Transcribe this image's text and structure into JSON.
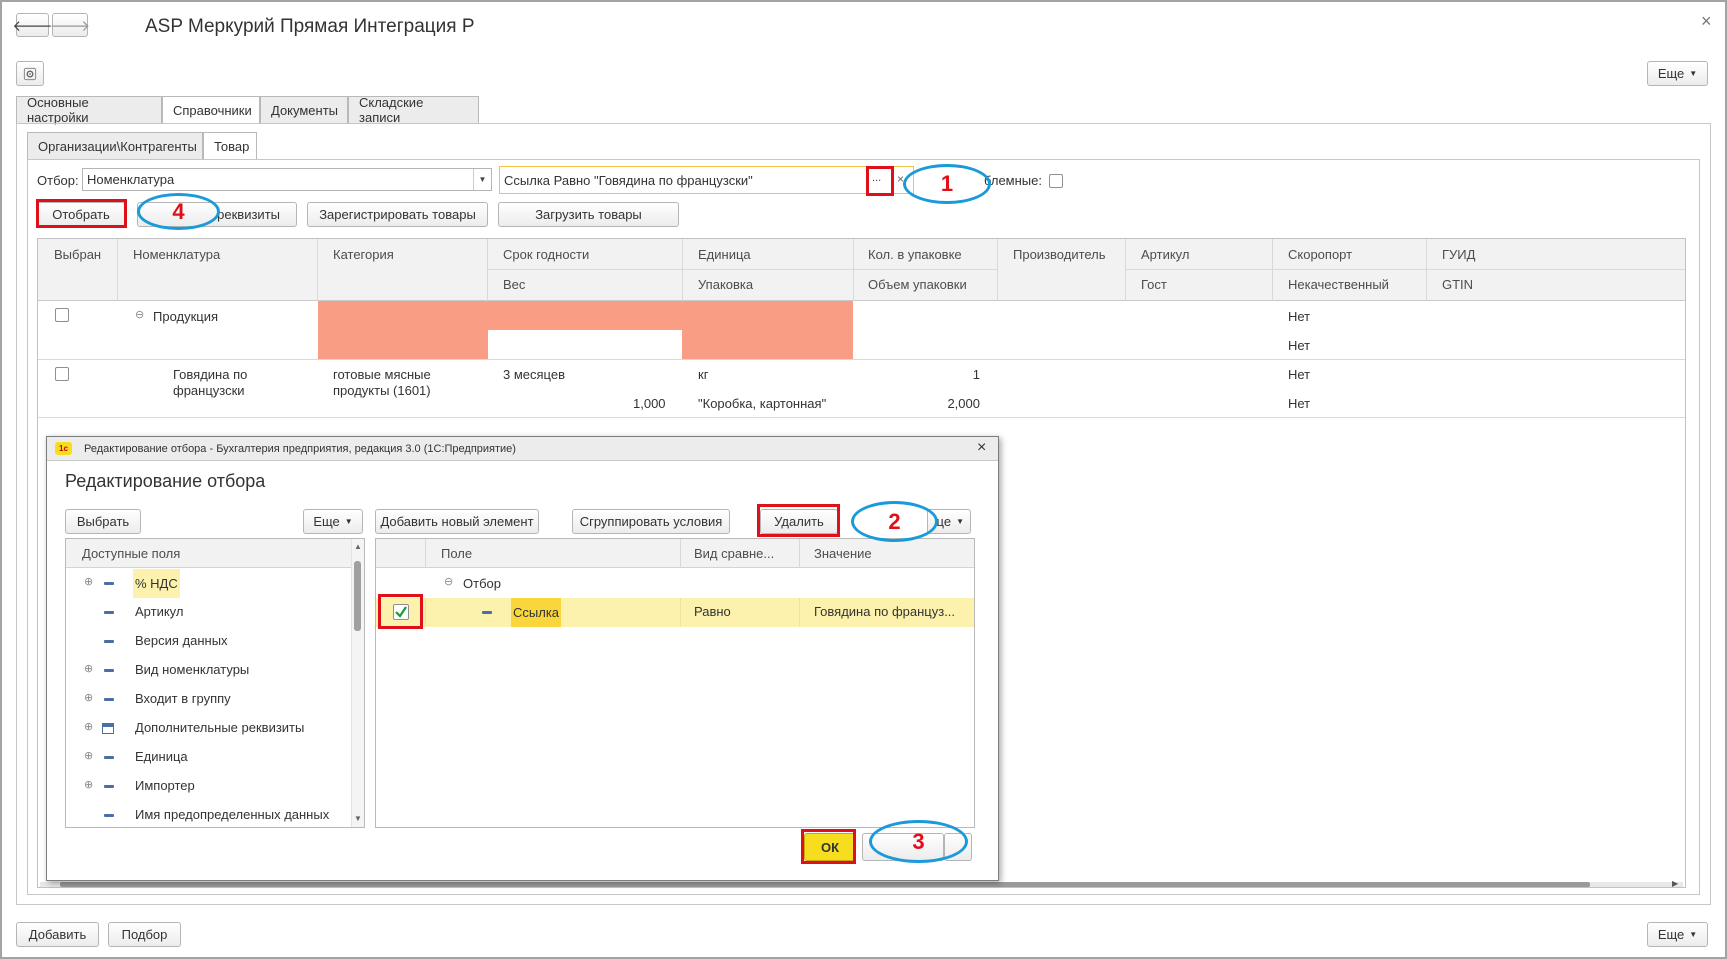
{
  "window": {
    "title": "ASP Меркурий Прямая Интеграция Р",
    "back_glyph": "🡐",
    "forward_glyph": "🡒",
    "close_glyph": "×",
    "more_label": "Еще"
  },
  "main_tabs": [
    {
      "label": "Основные настройки",
      "active": false
    },
    {
      "label": "Справочники",
      "active": true
    },
    {
      "label": "Документы",
      "active": false
    },
    {
      "label": "Складские записи",
      "active": false
    }
  ],
  "sub_tabs": [
    {
      "label": "Организации\\Контрагенты",
      "active": false
    },
    {
      "label": "Товар",
      "active": true
    }
  ],
  "filter": {
    "label": "Отбор:",
    "field_value": "Номенклатура",
    "condition_value": "Ссылка Равно \"Говядина по французски\"",
    "select_glyph": "...",
    "clear_glyph": "×",
    "problem_label": "блемные:"
  },
  "toolbar": {
    "select_label": "Отобрать",
    "fill_label": "реквизиты",
    "register_label": "Зарегистрировать товары",
    "load_label": "Загрузить товары"
  },
  "grid": {
    "headers_top": [
      "Выбран",
      "Номенклатура",
      "Категория",
      "Срок годности",
      "Единица",
      "Кол. в упаковке",
      "Производитель",
      "Артикул",
      "Скоропорт",
      "ГУИД"
    ],
    "headers_bottom": [
      "Вес",
      "Упаковка",
      "Объем упаковки",
      "Гост",
      "Некачественный",
      "GTIN"
    ],
    "group_row": {
      "name": "Продукция",
      "expand_glyph": "⊖",
      "perishable": "Нет",
      "defective": "Нет"
    },
    "item_row": {
      "name_line1": "Говядина по",
      "name_line2": "французски",
      "category_line1": "готовые мясные",
      "category_line2": "продукты (1601)",
      "shelf_life": "3 месяцев",
      "weight": "1,000",
      "unit": "кг",
      "package": "\"Коробка, картонная\"",
      "qty_in_pack": "1",
      "pack_volume": "2,000",
      "perishable": "Нет",
      "defective": "Нет"
    }
  },
  "dialog": {
    "window_title": "Редактирование отбора - Бухгалтерия предприятия, редакция 3.0  (1С:Предприятие)",
    "app_icon": "1с",
    "close_glyph": "×",
    "heading": "Редактирование отбора",
    "choose_label": "Выбрать",
    "more_label": "Еще",
    "add_element_label": "Добавить новый элемент",
    "group_conditions_label": "Сгруппировать условия",
    "delete_label": "Удалить",
    "more2_label": "це",
    "available_fields_header": "Доступные поля",
    "fields": [
      {
        "label": "% НДС",
        "expandable": true,
        "highlight": true
      },
      {
        "label": "Артикул",
        "expandable": false,
        "highlight": false
      },
      {
        "label": "Версия данных",
        "expandable": false,
        "highlight": false
      },
      {
        "label": "Вид номенклатуры",
        "expandable": true,
        "highlight": false
      },
      {
        "label": "Входит в группу",
        "expandable": true,
        "highlight": false
      },
      {
        "label": "Дополнительные реквизиты",
        "expandable": true,
        "highlight": false
      },
      {
        "label": "Единица",
        "expandable": true,
        "highlight": false
      },
      {
        "label": "Импортер",
        "expandable": true,
        "highlight": false
      },
      {
        "label": "Имя предопределенных данных",
        "expandable": false,
        "highlight": false
      }
    ],
    "conditions_headers": [
      "Поле",
      "Вид сравне...",
      "Значение"
    ],
    "group_node": "Отбор",
    "condition": {
      "field": "Ссылка",
      "comparison": "Равно",
      "value": "Говядина по француз..."
    },
    "ok_label": "ОК"
  },
  "callouts": [
    "1",
    "2",
    "3",
    "4"
  ],
  "bottom": {
    "add_label": "Добавить",
    "pick_label": "Подбор",
    "more_label": "Еще"
  },
  "colors": {
    "highlight_row": "#fcf2ad",
    "field_highlight": "#f9d73c",
    "ok_button": "#f6dd1e",
    "redacted": "#fa9d85",
    "annotation_red": "#e0101a",
    "annotation_blue": "#1a9ad9"
  }
}
